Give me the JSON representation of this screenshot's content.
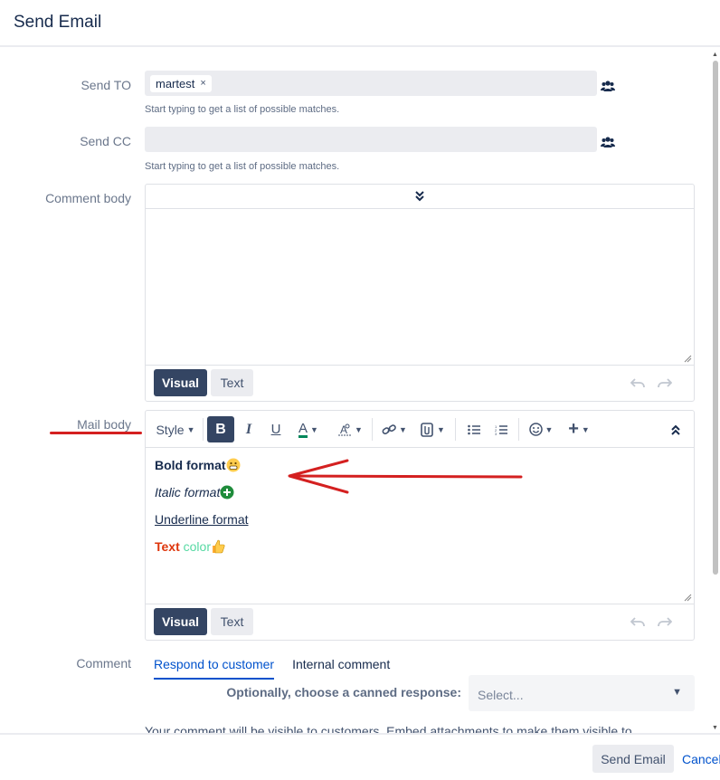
{
  "dialog": {
    "title": "Send Email"
  },
  "send_to": {
    "label": "Send TO",
    "tags": [
      {
        "label": "martest",
        "remove_glyph": "×"
      }
    ],
    "hint": "Start typing to get a list of possible matches.",
    "icon": "people-icon"
  },
  "send_cc": {
    "label": "Send CC",
    "hint": "Start typing to get a list of possible matches.",
    "icon": "people-icon"
  },
  "comment_body": {
    "label": "Comment body",
    "visual_label": "Visual",
    "text_label": "Text"
  },
  "mail_body": {
    "label": "Mail body",
    "toolbar": {
      "style_label": "Style",
      "bold_glyph": "B",
      "italic_glyph": "I",
      "underline_glyph": "U",
      "text_color_glyph": "A",
      "plus_glyph": "+"
    },
    "lines": {
      "bold": "Bold format",
      "italic": "Italic format",
      "underline": "Underline format",
      "colored_red": "Text",
      "colored_green": "color"
    },
    "visual_label": "Visual",
    "text_label": "Text"
  },
  "comment": {
    "label": "Comment",
    "tabs": [
      "Respond to customer",
      "Internal comment"
    ],
    "canned_label": "Optionally, choose a canned response:",
    "canned_placeholder": "Select...",
    "visibility_note": "Your comment will be visible to customers. Embed attachments to make them visible to"
  },
  "footer": {
    "send_label": "Send Email",
    "cancel_label": "Cancel"
  },
  "colors": {
    "primary_dark": "#344563",
    "link": "#0052cc",
    "annotation_red": "#d42020",
    "text_red": "#de350b",
    "text_green": "#57d9a3"
  }
}
